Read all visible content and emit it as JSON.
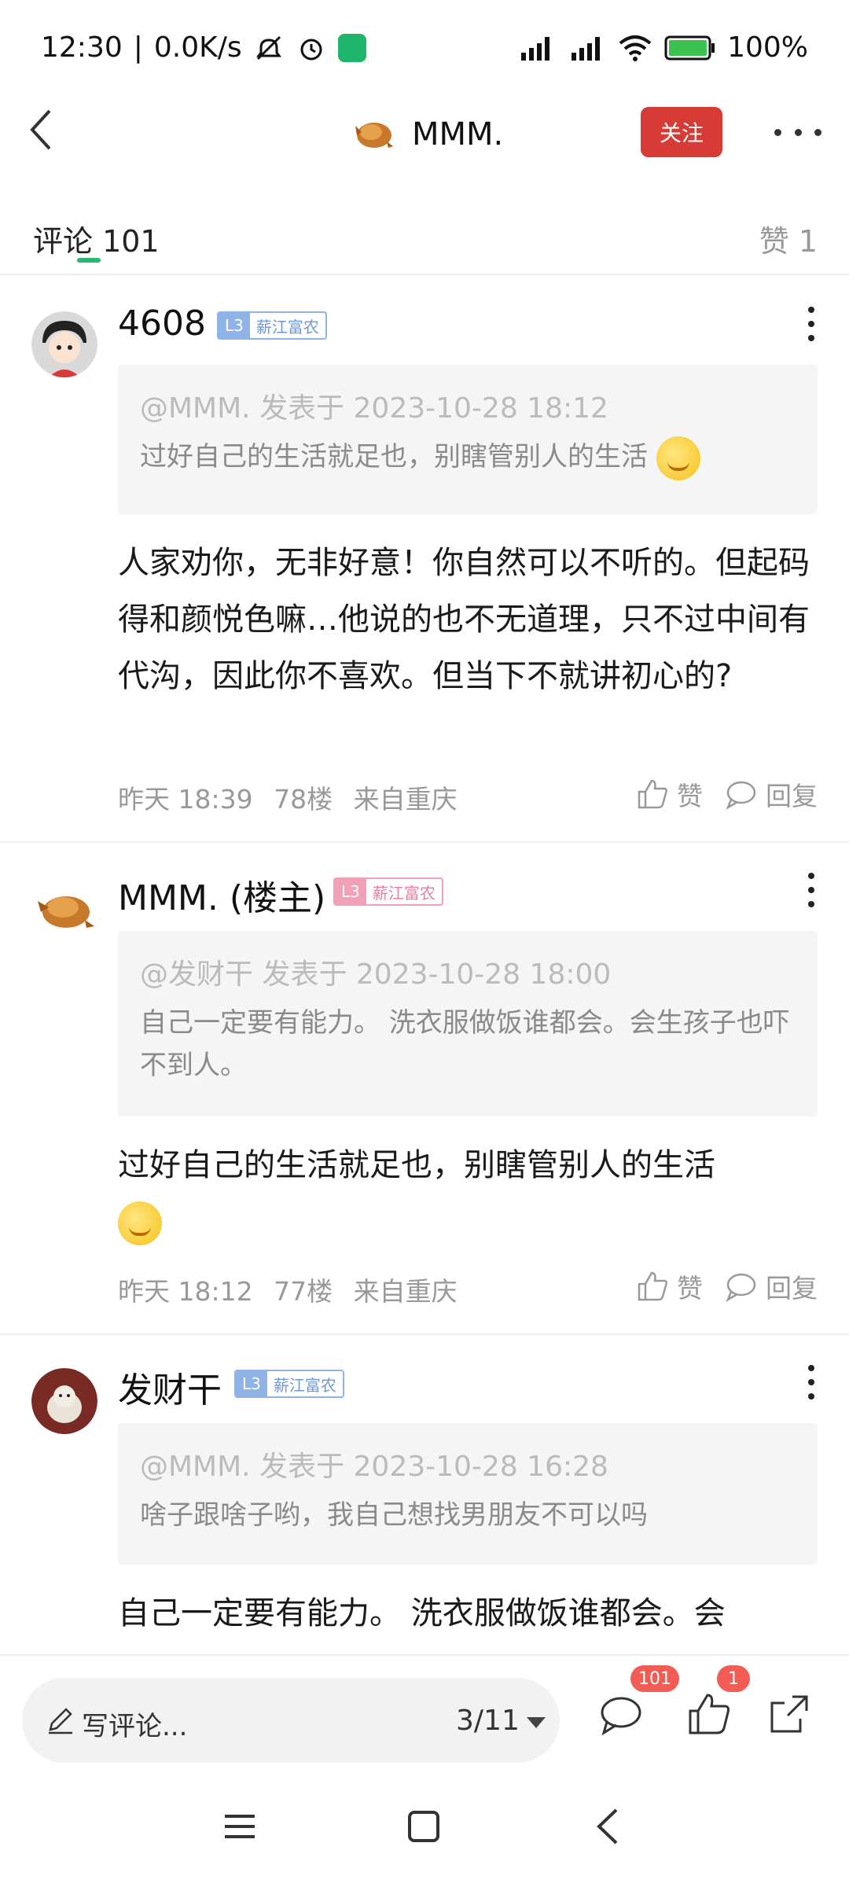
{
  "status_bar": {
    "time": "12:30",
    "network_speed": "0.0K/s",
    "battery": "100%",
    "network_icons": [
      "mute-icon",
      "alarm-icon",
      "shield-icon",
      "signal-hd-icon",
      "signal-hd-icon",
      "wifi-icon",
      "battery-icon"
    ]
  },
  "header": {
    "title": "MMM.",
    "follow_label": "关注"
  },
  "tabs": {
    "comments_label": "评论 101",
    "likes_label": "赞 1"
  },
  "comments": [
    {
      "username": "4608",
      "badge_level": "L3",
      "badge_tag": "薪江富农",
      "quote_meta": "@MMM. 发表于 2023-10-28 18:12",
      "quote_text": "过好自己的生活就足也，别瞎管别人的生活",
      "body": "人家劝你，无非好意！你自然可以不听的。但起码得和颜悦色嘛…他说的也不无道理，只不过中间有代沟，因此你不喜欢。但当下不就讲初心的?",
      "time": "昨天 18:39",
      "floor": "78楼",
      "location": "来自重庆",
      "like_label": "赞",
      "reply_label": "回复"
    },
    {
      "username": "MMM. (楼主)",
      "badge_level": "L3",
      "badge_tag": "薪江富农",
      "quote_meta": "@发财干 发表于 2023-10-28 18:00",
      "quote_text": "自己一定要有能力。 洗衣服做饭谁都会。会生孩子也吓不到人。",
      "body": "过好自己的生活就足也，别瞎管别人的生活",
      "time": "昨天 18:12",
      "floor": "77楼",
      "location": "来自重庆",
      "like_label": "赞",
      "reply_label": "回复"
    },
    {
      "username": "发财干",
      "badge_level": "L3",
      "badge_tag": "薪江富农",
      "quote_meta": "@MMM. 发表于 2023-10-28 16:28",
      "quote_text": "啥子跟啥子哟，我自己想找男朋友不可以吗",
      "body": "自己一定要有能力。 洗衣服做饭谁都会。会"
    }
  ],
  "bottom_bar": {
    "write_placeholder": "写评论...",
    "page_indicator": "3/11",
    "comment_count": "101",
    "like_count": "1"
  },
  "colors": {
    "accent_green": "#2ab673",
    "follow_red": "#d63b36",
    "badge_blue": "#8fb3e6",
    "badge_pink": "#f2a0b6",
    "count_badge": "#f25c54"
  }
}
